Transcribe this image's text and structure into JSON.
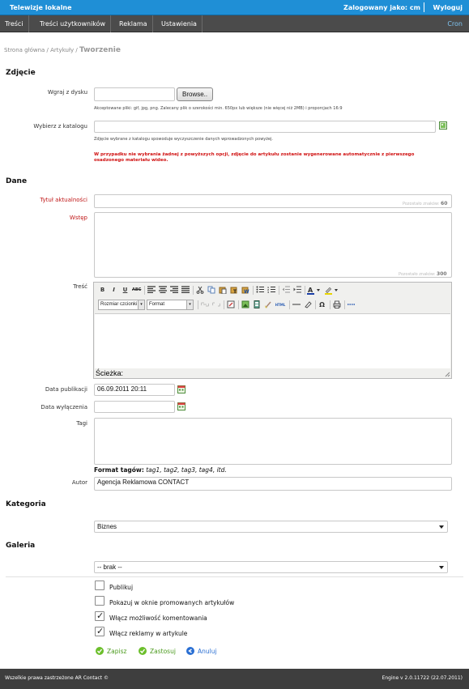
{
  "header": {
    "app_title": "Telewizje lokalne",
    "logged_in_label": "Zalogowany jako: cm",
    "logout_label": "Wyloguj"
  },
  "nav": {
    "items": [
      "Treści",
      "Treści użytkowników",
      "Reklama",
      "Ustawienia"
    ],
    "cron_label": "Cron"
  },
  "breadcrumb": {
    "home": "Strona główna",
    "articles": "Artykuły",
    "current": "Tworzenie",
    "separator": "/"
  },
  "photo_section": {
    "title": "Zdjęcie",
    "upload_label": "Wgraj z dysku",
    "browse_label": "Browse..",
    "upload_hint": "Akceptowane pliki: gif, jpg, png. Zalecany plik o szerokości min. 650px lub większe (nie więcej niż 2MB) i proporcjach 16:9",
    "catalog_label": "Wybierz z katalogu",
    "catalog_value": "",
    "catalog_hint": "Zdjęcie wybrane z katalogu spowoduje wyczyszczenie danych wprowadzonych powyżej.",
    "warning": "W przypadku nie wybrania żadnej z powyższych opcji, zdjęcie do artykułu zostanie wygenerowane automatycznie z pierwszego osadzonego materiału wideo."
  },
  "data_section": {
    "title": "Dane",
    "title_label": "Tytuł aktualności",
    "title_value": "",
    "title_counter_text": "Pozostało znaków:",
    "title_counter": "60",
    "lead_label": "Wstęp",
    "lead_value": "",
    "lead_counter_text": "Pozostało znaków:",
    "lead_counter": "300",
    "content_label": "Treść",
    "editor": {
      "font_size_select": "Rozmiar czcionki",
      "format_select": "Format",
      "path_label": "Ścieżka:"
    },
    "pub_date_label": "Data publikacji",
    "pub_date_value": "06.09.2011 20:11",
    "off_date_label": "Data wyłączenia",
    "off_date_value": "",
    "tags_label": "Tagi",
    "tags_value": "",
    "tag_format_title": "Format tagów:",
    "tag_format_example": "tag1, tag2, tag3, tag4, itd.",
    "author_label": "Autor",
    "author_value": "Agencja Reklamowa CONTACT"
  },
  "category_section": {
    "title": "Kategoria",
    "selected": "Biznes"
  },
  "gallery_section": {
    "title": "Galeria",
    "selected": "-- brak --"
  },
  "options": [
    {
      "label": "Publikuj",
      "checked": false
    },
    {
      "label": "Pokazuj w oknie promowanych artykułów",
      "checked": false
    },
    {
      "label": "Włącz możliwość komentowania",
      "checked": true
    },
    {
      "label": "Włącz reklamy w artykule",
      "checked": true
    }
  ],
  "actions": {
    "save": "Zapisz",
    "apply": "Zastosuj",
    "cancel": "Anuluj"
  },
  "colors": {
    "topbar": "#1f8fd6",
    "navbar": "#4b4b4b",
    "required_label": "#c01818",
    "warning": "#d01010",
    "action_green": "#6cbf2c",
    "action_blue": "#2a6fd3",
    "cron": "#7fc4f0"
  },
  "footer": {
    "left": "Wszelkie prawa zastrzeżone AR Contact ©",
    "right": "Engine v 2.0.11722 (22.07.2011)"
  }
}
